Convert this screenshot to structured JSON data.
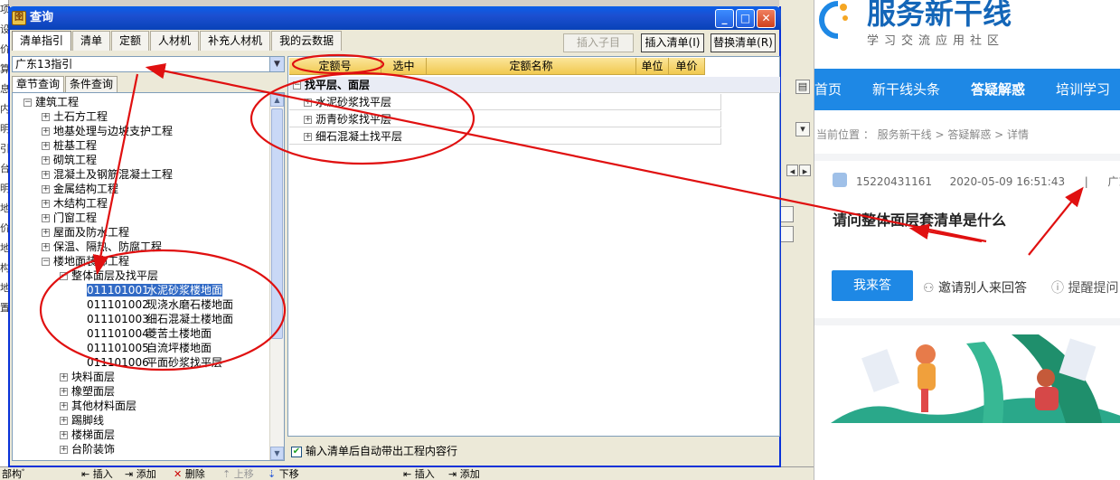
{
  "background_app": {
    "left_strip_chars": [
      "项",
      "设",
      "价",
      "算",
      "息",
      "内",
      "明",
      "引",
      "台",
      "明",
      "地",
      "价",
      "地",
      "构",
      "地",
      "置"
    ],
    "bottom_bar": [
      "部构ﾞ",
      "插入",
      "添加",
      "删除",
      "上移",
      "下移",
      "插入",
      "添加"
    ]
  },
  "dialog": {
    "title": "查询",
    "window_buttons": {
      "minimize": "_",
      "maximize": "□",
      "close": "✕"
    },
    "top_tabs": [
      "清单指引",
      "清单",
      "定额",
      "人材机",
      "补充人材机",
      "我的云数据"
    ],
    "insert_sub_button": "插入子目",
    "insert_list_button": "插入清单(I)",
    "replace_list_button": "替换清单(R)",
    "guide_select_value": "广东13指引",
    "sub_tabs": [
      "章节查询",
      "条件查询"
    ],
    "tree": [
      {
        "indent": 0,
        "toggle": "⊟",
        "label": "建筑工程"
      },
      {
        "indent": 1,
        "toggle": "+",
        "label": "土石方工程"
      },
      {
        "indent": 1,
        "toggle": "+",
        "label": "地基处理与边坡支护工程"
      },
      {
        "indent": 1,
        "toggle": "+",
        "label": "桩基工程"
      },
      {
        "indent": 1,
        "toggle": "+",
        "label": "砌筑工程"
      },
      {
        "indent": 1,
        "toggle": "+",
        "label": "混凝土及钢筋混凝土工程"
      },
      {
        "indent": 1,
        "toggle": "+",
        "label": "金属结构工程"
      },
      {
        "indent": 1,
        "toggle": "+",
        "label": "木结构工程"
      },
      {
        "indent": 1,
        "toggle": "+",
        "label": "门窗工程"
      },
      {
        "indent": 1,
        "toggle": "+",
        "label": "屋面及防水工程"
      },
      {
        "indent": 1,
        "toggle": "+",
        "label": "保温、隔热、防腐工程"
      },
      {
        "indent": 1,
        "toggle": "−",
        "label": "楼地面装饰工程"
      },
      {
        "indent": 2,
        "toggle": "⊟",
        "label": "整体面层及找平层"
      },
      {
        "indent": 3,
        "code": "011101001",
        "label": "水泥砂浆楼地面",
        "selected": true
      },
      {
        "indent": 3,
        "code": "011101002",
        "label": "现浇水磨石楼地面"
      },
      {
        "indent": 3,
        "code": "011101003",
        "label": "细石混凝土楼地面"
      },
      {
        "indent": 3,
        "code": "011101004",
        "label": "菱苦土楼地面"
      },
      {
        "indent": 3,
        "code": "011101005",
        "label": "自流坪楼地面"
      },
      {
        "indent": 3,
        "code": "011101006",
        "label": "平面砂浆找平层"
      },
      {
        "indent": 2,
        "toggle": "+",
        "label": "块料面层"
      },
      {
        "indent": 2,
        "toggle": "+",
        "label": "橡塑面层"
      },
      {
        "indent": 2,
        "toggle": "+",
        "label": "其他材料面层"
      },
      {
        "indent": 2,
        "toggle": "+",
        "label": "踢脚线"
      },
      {
        "indent": 2,
        "toggle": "+",
        "label": "楼梯面层"
      },
      {
        "indent": 2,
        "toggle": "+",
        "label": "台阶装饰"
      }
    ],
    "grid": {
      "columns": [
        "定额号",
        "选中",
        "定额名称",
        "单位",
        "单价"
      ],
      "group": "找平层、面层",
      "items": [
        "水泥砂浆找平层",
        "沥青砂浆找平层",
        "细石混凝土找平层"
      ]
    },
    "auto_bring_label": "输入清单后自动带出工程内容行"
  },
  "web": {
    "site_name": "服务新干线",
    "slogan": "学习交流应用社区",
    "nav": [
      "首页",
      "新干线头条",
      "答疑解惑",
      "培训学习"
    ],
    "breadcrumb": "当前位置 ： 服务新干线 > 答疑解惑 > 详情",
    "meta": {
      "user": "15220431161",
      "datetime": "2020-05-09 16:51:43",
      "separator": "|",
      "region": "广东省"
    },
    "question_title": "请问整体面层套清单是什么",
    "answer_button": "我来答",
    "invite_label": "邀请别人来回答",
    "remind_label": "提醒提问"
  },
  "colors": {
    "annotation": "#e01010",
    "accent": "#1e88e5",
    "selection": "#316ac5",
    "grid_header": "#f1c950"
  }
}
